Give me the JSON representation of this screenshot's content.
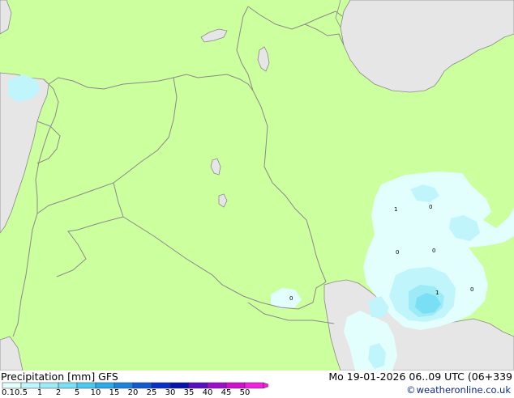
{
  "footer": {
    "title": "Precipitation [mm] GFS",
    "datetime": "Mo 19-01-2026 06..09 UTC (06+339",
    "credit": "weatheronline.co.uk"
  },
  "legend": {
    "ticks": [
      "0.1",
      "0.5",
      "1",
      "2",
      "5",
      "10",
      "15",
      "20",
      "25",
      "30",
      "35",
      "40",
      "45",
      "50"
    ],
    "colors": [
      "#e2fffe",
      "#c0f5fb",
      "#9eebf8",
      "#78dff5",
      "#4ec9ee",
      "#2aaae6",
      "#1c82dc",
      "#135ad0",
      "#0a30c4",
      "#0613a8",
      "#5a0fbf",
      "#9a10c8",
      "#d010d0",
      "#ef22e2"
    ]
  },
  "map": {
    "land_color": "#ccff9e",
    "sea_color": "#e6e6e6",
    "border_color": "#8a8a8a",
    "precip_labels": [
      "1",
      "0",
      "0",
      "0",
      "1",
      "0",
      "0"
    ]
  }
}
